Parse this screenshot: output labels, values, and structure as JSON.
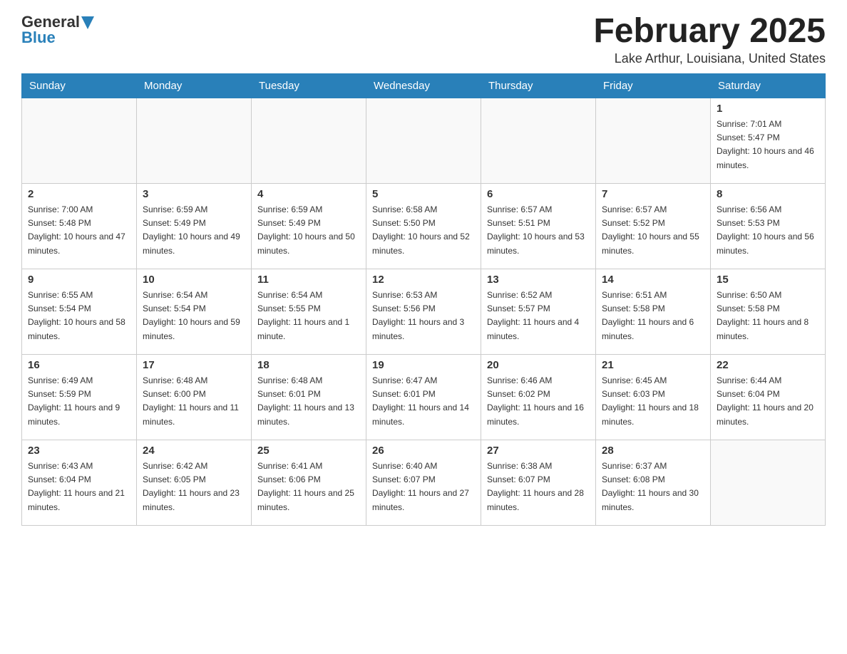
{
  "header": {
    "logo_general": "General",
    "logo_blue": "Blue",
    "month_title": "February 2025",
    "location": "Lake Arthur, Louisiana, United States"
  },
  "days_of_week": [
    "Sunday",
    "Monday",
    "Tuesday",
    "Wednesday",
    "Thursday",
    "Friday",
    "Saturday"
  ],
  "weeks": [
    [
      {
        "day": "",
        "empty": true
      },
      {
        "day": "",
        "empty": true
      },
      {
        "day": "",
        "empty": true
      },
      {
        "day": "",
        "empty": true
      },
      {
        "day": "",
        "empty": true
      },
      {
        "day": "",
        "empty": true
      },
      {
        "day": "1",
        "sunrise": "Sunrise: 7:01 AM",
        "sunset": "Sunset: 5:47 PM",
        "daylight": "Daylight: 10 hours and 46 minutes."
      }
    ],
    [
      {
        "day": "2",
        "sunrise": "Sunrise: 7:00 AM",
        "sunset": "Sunset: 5:48 PM",
        "daylight": "Daylight: 10 hours and 47 minutes."
      },
      {
        "day": "3",
        "sunrise": "Sunrise: 6:59 AM",
        "sunset": "Sunset: 5:49 PM",
        "daylight": "Daylight: 10 hours and 49 minutes."
      },
      {
        "day": "4",
        "sunrise": "Sunrise: 6:59 AM",
        "sunset": "Sunset: 5:49 PM",
        "daylight": "Daylight: 10 hours and 50 minutes."
      },
      {
        "day": "5",
        "sunrise": "Sunrise: 6:58 AM",
        "sunset": "Sunset: 5:50 PM",
        "daylight": "Daylight: 10 hours and 52 minutes."
      },
      {
        "day": "6",
        "sunrise": "Sunrise: 6:57 AM",
        "sunset": "Sunset: 5:51 PM",
        "daylight": "Daylight: 10 hours and 53 minutes."
      },
      {
        "day": "7",
        "sunrise": "Sunrise: 6:57 AM",
        "sunset": "Sunset: 5:52 PM",
        "daylight": "Daylight: 10 hours and 55 minutes."
      },
      {
        "day": "8",
        "sunrise": "Sunrise: 6:56 AM",
        "sunset": "Sunset: 5:53 PM",
        "daylight": "Daylight: 10 hours and 56 minutes."
      }
    ],
    [
      {
        "day": "9",
        "sunrise": "Sunrise: 6:55 AM",
        "sunset": "Sunset: 5:54 PM",
        "daylight": "Daylight: 10 hours and 58 minutes."
      },
      {
        "day": "10",
        "sunrise": "Sunrise: 6:54 AM",
        "sunset": "Sunset: 5:54 PM",
        "daylight": "Daylight: 10 hours and 59 minutes."
      },
      {
        "day": "11",
        "sunrise": "Sunrise: 6:54 AM",
        "sunset": "Sunset: 5:55 PM",
        "daylight": "Daylight: 11 hours and 1 minute."
      },
      {
        "day": "12",
        "sunrise": "Sunrise: 6:53 AM",
        "sunset": "Sunset: 5:56 PM",
        "daylight": "Daylight: 11 hours and 3 minutes."
      },
      {
        "day": "13",
        "sunrise": "Sunrise: 6:52 AM",
        "sunset": "Sunset: 5:57 PM",
        "daylight": "Daylight: 11 hours and 4 minutes."
      },
      {
        "day": "14",
        "sunrise": "Sunrise: 6:51 AM",
        "sunset": "Sunset: 5:58 PM",
        "daylight": "Daylight: 11 hours and 6 minutes."
      },
      {
        "day": "15",
        "sunrise": "Sunrise: 6:50 AM",
        "sunset": "Sunset: 5:58 PM",
        "daylight": "Daylight: 11 hours and 8 minutes."
      }
    ],
    [
      {
        "day": "16",
        "sunrise": "Sunrise: 6:49 AM",
        "sunset": "Sunset: 5:59 PM",
        "daylight": "Daylight: 11 hours and 9 minutes."
      },
      {
        "day": "17",
        "sunrise": "Sunrise: 6:48 AM",
        "sunset": "Sunset: 6:00 PM",
        "daylight": "Daylight: 11 hours and 11 minutes."
      },
      {
        "day": "18",
        "sunrise": "Sunrise: 6:48 AM",
        "sunset": "Sunset: 6:01 PM",
        "daylight": "Daylight: 11 hours and 13 minutes."
      },
      {
        "day": "19",
        "sunrise": "Sunrise: 6:47 AM",
        "sunset": "Sunset: 6:01 PM",
        "daylight": "Daylight: 11 hours and 14 minutes."
      },
      {
        "day": "20",
        "sunrise": "Sunrise: 6:46 AM",
        "sunset": "Sunset: 6:02 PM",
        "daylight": "Daylight: 11 hours and 16 minutes."
      },
      {
        "day": "21",
        "sunrise": "Sunrise: 6:45 AM",
        "sunset": "Sunset: 6:03 PM",
        "daylight": "Daylight: 11 hours and 18 minutes."
      },
      {
        "day": "22",
        "sunrise": "Sunrise: 6:44 AM",
        "sunset": "Sunset: 6:04 PM",
        "daylight": "Daylight: 11 hours and 20 minutes."
      }
    ],
    [
      {
        "day": "23",
        "sunrise": "Sunrise: 6:43 AM",
        "sunset": "Sunset: 6:04 PM",
        "daylight": "Daylight: 11 hours and 21 minutes."
      },
      {
        "day": "24",
        "sunrise": "Sunrise: 6:42 AM",
        "sunset": "Sunset: 6:05 PM",
        "daylight": "Daylight: 11 hours and 23 minutes."
      },
      {
        "day": "25",
        "sunrise": "Sunrise: 6:41 AM",
        "sunset": "Sunset: 6:06 PM",
        "daylight": "Daylight: 11 hours and 25 minutes."
      },
      {
        "day": "26",
        "sunrise": "Sunrise: 6:40 AM",
        "sunset": "Sunset: 6:07 PM",
        "daylight": "Daylight: 11 hours and 27 minutes."
      },
      {
        "day": "27",
        "sunrise": "Sunrise: 6:38 AM",
        "sunset": "Sunset: 6:07 PM",
        "daylight": "Daylight: 11 hours and 28 minutes."
      },
      {
        "day": "28",
        "sunrise": "Sunrise: 6:37 AM",
        "sunset": "Sunset: 6:08 PM",
        "daylight": "Daylight: 11 hours and 30 minutes."
      },
      {
        "day": "",
        "empty": true
      }
    ]
  ]
}
